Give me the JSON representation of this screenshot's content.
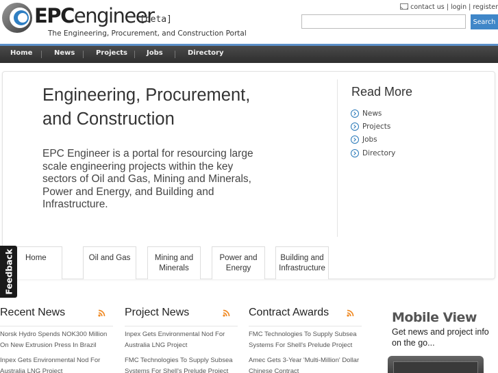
{
  "header": {
    "logo_epc": "EPC",
    "logo_engineer": "engineer",
    "beta": "[beta]",
    "tagline": "The Engineering, Procurement, and Construction Portal",
    "links": {
      "contact": "contact us",
      "sep": " | ",
      "login": "login",
      "register": "register"
    },
    "search": {
      "value": "",
      "button": "Search"
    }
  },
  "nav": [
    "Home",
    "News",
    "Projects",
    "Jobs",
    "Directory"
  ],
  "hero": {
    "title": "Engineering, Procurement, and Construction",
    "text": "EPC Engineer is a portal for resourcing large scale engineering projects within the key sectors of Oil and Gas, Mining and Minerals, Power and Energy, and Building and Infrastructure.",
    "read_more": {
      "title": "Read More",
      "items": [
        "News",
        "Projects",
        "Jobs",
        "Directory"
      ]
    }
  },
  "tabs": [
    {
      "line1": "Home",
      "line2": ""
    },
    {
      "line1": "Oil and Gas",
      "line2": ""
    },
    {
      "line1": "Mining and",
      "line2": "Minerals"
    },
    {
      "line1": "Power and",
      "line2": "Energy"
    },
    {
      "line1": "Building and",
      "line2": "Infrastructure"
    }
  ],
  "feedback": "Feedback",
  "columns": [
    {
      "title": "Recent News",
      "items": [
        {
          "line1": "Norsk Hydro Spends NOK300 Million",
          "line2": "On New Extrusion Press In Brazil"
        },
        {
          "line1": "Inpex Gets Environmental Nod For",
          "line2": "Australia LNG Project"
        }
      ]
    },
    {
      "title": "Project News",
      "items": [
        {
          "line1": "Inpex Gets Environmental Nod For",
          "line2": "Australia LNG Project"
        },
        {
          "line1": "FMC Technologies To Supply Subsea",
          "line2": "Systems For Shell's Prelude Project"
        }
      ]
    },
    {
      "title": "Contract Awards",
      "items": [
        {
          "line1": "FMC Technologies To Supply Subsea",
          "line2": "Systems For Shell's Prelude Project"
        },
        {
          "line1": "Amec Gets 3-Year 'Multi-Million' Dollar",
          "line2": "Chinese Contract"
        }
      ]
    }
  ],
  "mobile": {
    "title": "Mobile View",
    "subtitle": "Get news and project info on the go..."
  },
  "colors": {
    "accent": "#3f86c8",
    "nav_bg": "#333333",
    "nav_line": "#5b8fc9",
    "rss": "#f08a24"
  },
  "icons": {
    "logo": "epc-logo-icon",
    "mail": "mail-icon",
    "read_more": "chevron-circle-icon",
    "feed": "rss-icon"
  }
}
